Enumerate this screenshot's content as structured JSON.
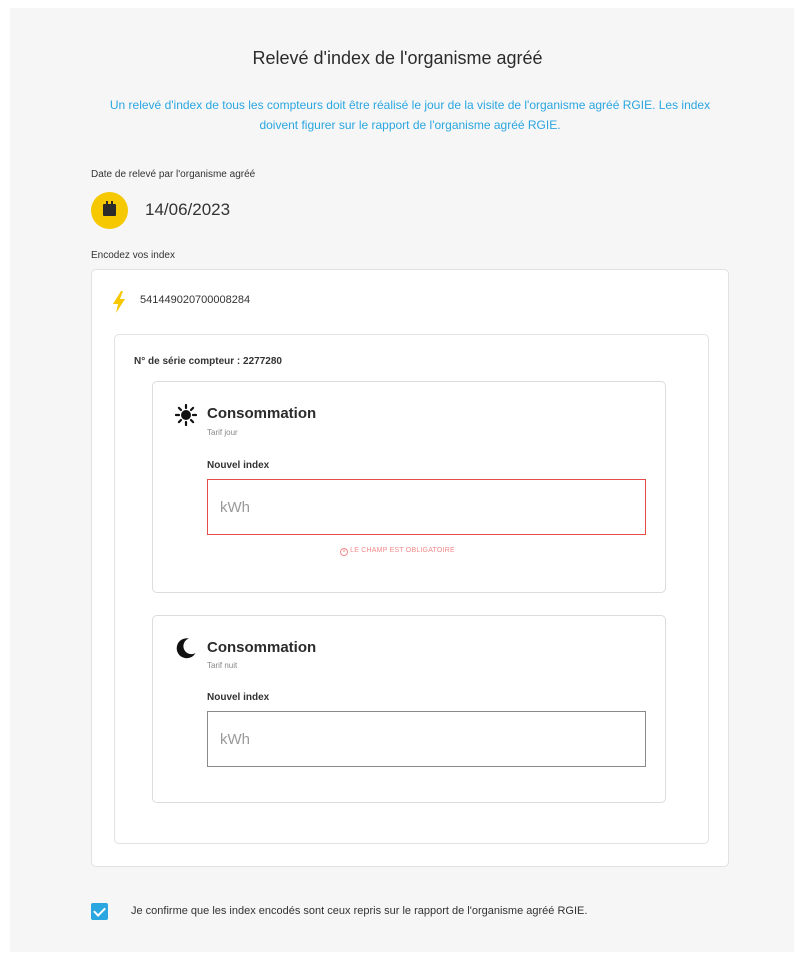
{
  "page": {
    "title": "Relevé d'index de l'organisme agréé",
    "subtitle": "Un relevé d'index de tous les compteurs doit être réalisé le jour de la visite de l'organisme agréé RGIE. Les index doivent figurer sur le rapport de l'organisme agréé RGIE."
  },
  "date": {
    "label": "Date de relevé par l'organisme agréé",
    "value": "14/06/2023",
    "icon": "calendar-icon"
  },
  "encode": {
    "label": "Encodez vos index",
    "ean": "541449020700008284",
    "icon": "lightning-icon"
  },
  "meter": {
    "serial_label": "N° de série compteur : 2277280",
    "day": {
      "icon": "sun-icon",
      "title": "Consommation",
      "subtitle": "Tarif jour",
      "field_label": "Nouvel index",
      "placeholder": "kWh",
      "value": "",
      "error": "LE CHAMP EST OBLIGATOIRE"
    },
    "night": {
      "icon": "moon-icon",
      "title": "Consommation",
      "subtitle": "Tarif nuit",
      "field_label": "Nouvel index",
      "placeholder": "kWh",
      "value": ""
    }
  },
  "confirm": {
    "checked": true,
    "label": "Je confirme que les index encodés sont ceux repris sur le rapport de l'organisme agréé RGIE."
  },
  "colors": {
    "accent": "#2aa6e0",
    "date_circle": "#f6c800",
    "bolt": "#f6c800",
    "error": "#e74c4c",
    "background": "#f6f6f6"
  }
}
